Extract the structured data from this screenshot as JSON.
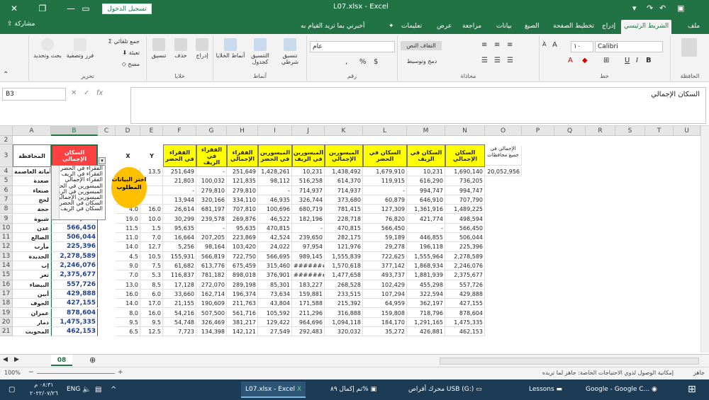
{
  "window": {
    "title": "L07.xlsx - Excel",
    "login_label": "تسجيل الدخول"
  },
  "ribbon_tabs": [
    "ملف",
    "الشريط الرئيسي",
    "إدراج",
    "تخطيط الصفحة",
    "الصيغ",
    "بيانات",
    "مراجعة",
    "عرض",
    "تعليمات"
  ],
  "tell_me": "أخبرني بما تريد القيام به",
  "share_label": "مشاركة",
  "ribbon": {
    "clipboard_label": "الحافظة",
    "font_label": "خط",
    "font_name": "Calibri",
    "font_size": "١٠",
    "alignment_label": "محاذاة",
    "wrap_text": "التفاف النص",
    "merge_center": "دمج وتوسيط",
    "number_label": "رقم",
    "number_format": "عام",
    "styles_label": "أنماط",
    "conditional_format": "تنسيق شرطي",
    "format_as_table": "التنسيق كجدول",
    "cell_styles": "أنماط الخلايا",
    "cells_label": "خلايا",
    "insert": "إدراج",
    "delete": "حذف",
    "format": "تنسيق",
    "editing_label": "تحرير",
    "autosum": "جمع تلقائي",
    "fill": "تعبئة",
    "clear": "مسح",
    "sort_filter": "فرز وتصفية",
    "find_select": "بحث وتحديد"
  },
  "formula": {
    "name_box": "B3",
    "content": "السكان الإجمالي"
  },
  "columns": [
    "A",
    "B",
    "C",
    "D",
    "E",
    "F",
    "G",
    "H",
    "I",
    "J",
    "K",
    "L",
    "M",
    "N",
    "O",
    "P",
    "Q",
    "R",
    "S",
    "T",
    "U"
  ],
  "headers": {
    "A": "المحافظة",
    "B": "السكان الإجمالي",
    "D": "X",
    "E": "Y",
    "F": "الفقراء في الحضر",
    "G": "الفقراء في الريف",
    "H": "الفقراء الإجمالي",
    "I": "الميسورين في الحضر",
    "J": "الميسورين في الريف",
    "K": "الميسورين الإجمالي",
    "L": "السكان في الحضر",
    "M": "السكان في الريف",
    "N": "السكان الإجمالي",
    "O": "الإجمالي في جميع محافظات",
    "O_value": "20,052,956"
  },
  "dropdown_items": [
    "الفقراء في الحضر",
    "الفقراء في الريف",
    "الفقراء الإجمالي",
    "الميسورين في الحضر",
    "الميسورين في الريف",
    "الميسورين الإجمالي",
    "السكان في الحضر",
    "السكان في الريف"
  ],
  "callout": "اختر البيانات المطلوب",
  "rows": [
    {
      "n": "4",
      "A": "أمانة العاصمة",
      "B": "",
      "D": "",
      "E": "13.5",
      "F": "251,649",
      "G": "-",
      "H": "251,649",
      "I": "1,428,261",
      "J": "10,231",
      "K": "1,438,492",
      "L": "1,679,910",
      "M": "10,231",
      "N": "1,690,140"
    },
    {
      "n": "5",
      "A": "صعدة",
      "B": "",
      "D": "",
      "E": "",
      "F": "21,803",
      "G": "100,032",
      "H": "121,835",
      "I": "98,112",
      "J": "516,258",
      "K": "614,370",
      "L": "119,915",
      "M": "616,290",
      "N": "736,205"
    },
    {
      "n": "6",
      "A": "صنعاء",
      "B": "",
      "D": "",
      "E": "",
      "F": "-",
      "G": "279,810",
      "H": "279,810",
      "I": "-",
      "J": "714,937",
      "K": "714,937",
      "L": "-",
      "M": "994,747",
      "N": "994,747"
    },
    {
      "n": "7",
      "A": "لحج",
      "B": "",
      "D": "",
      "E": "",
      "F": "13,944",
      "G": "320,166",
      "H": "334,110",
      "I": "46,935",
      "J": "326,744",
      "K": "373,680",
      "L": "60,879",
      "M": "646,910",
      "N": "707,790"
    },
    {
      "n": "8",
      "A": "حجة",
      "B": "",
      "D": "4.0",
      "E": "16.0",
      "F": "26,614",
      "G": "681,197",
      "H": "707,810",
      "I": "100,696",
      "J": "680,719",
      "K": "781,415",
      "L": "127,309",
      "M": "1,361,916",
      "N": "1,489,225"
    },
    {
      "n": "9",
      "A": "شبوة",
      "B": "498,594",
      "D": "19.0",
      "E": "10.0",
      "F": "30,299",
      "G": "239,578",
      "H": "269,876",
      "I": "46,522",
      "J": "182,196",
      "K": "228,718",
      "L": "76,820",
      "M": "421,774",
      "N": "498,594"
    },
    {
      "n": "10",
      "A": "عدن",
      "B": "566,450",
      "D": "11.5",
      "E": "1.5",
      "F": "95,635",
      "G": "-",
      "H": "95,635",
      "I": "470,815",
      "J": "-",
      "K": "470,815",
      "L": "566,450",
      "M": "-",
      "N": "566,450"
    },
    {
      "n": "11",
      "A": "الضالع",
      "B": "506,044",
      "D": "11.0",
      "E": "7.0",
      "F": "16,664",
      "G": "207,205",
      "H": "223,869",
      "I": "42,524",
      "J": "239,650",
      "K": "282,175",
      "L": "59,189",
      "M": "446,855",
      "N": "506,044"
    },
    {
      "n": "12",
      "A": "مأرب",
      "B": "225,396",
      "D": "14.0",
      "E": "12.7",
      "F": "5,256",
      "G": "98,164",
      "H": "103,420",
      "I": "24,022",
      "J": "97,954",
      "K": "121,976",
      "L": "29,278",
      "M": "196,118",
      "N": "225,396"
    },
    {
      "n": "13",
      "A": "الحديدة",
      "B": "2,278,589",
      "D": "4.5",
      "E": "10.5",
      "F": "155,931",
      "G": "566,819",
      "H": "722,750",
      "I": "566,695",
      "J": "989,145",
      "K": "1,555,839",
      "L": "722,625",
      "M": "1,555,964",
      "N": "2,278,589"
    },
    {
      "n": "14",
      "A": "إب",
      "B": "2,246,076",
      "D": "9.0",
      "E": "7.5",
      "F": "61,682",
      "G": "613,776",
      "H": "675,459",
      "I": "315,460",
      "J": "#######",
      "K": "1,570,618",
      "L": "377,142",
      "M": "1,868,934",
      "N": "2,246,076"
    },
    {
      "n": "15",
      "A": "تعز",
      "B": "2,375,677",
      "D": "7.0",
      "E": "5.3",
      "F": "116,837",
      "G": "781,182",
      "H": "898,018",
      "I": "376,901",
      "J": "#######",
      "K": "1,477,658",
      "L": "493,737",
      "M": "1,881,939",
      "N": "2,375,677"
    },
    {
      "n": "16",
      "A": "البيضاء",
      "B": "557,726",
      "D": "13.0",
      "E": "8.5",
      "F": "17,128",
      "G": "272,070",
      "H": "289,198",
      "I": "85,301",
      "J": "183,227",
      "K": "268,528",
      "L": "102,429",
      "M": "455,298",
      "N": "557,726"
    },
    {
      "n": "17",
      "A": "أبين",
      "B": "429,888",
      "D": "16.0",
      "E": "6.0",
      "F": "33,660",
      "G": "162,714",
      "H": "196,374",
      "I": "73,634",
      "J": "159,881",
      "K": "233,515",
      "L": "107,294",
      "M": "322,594",
      "N": "429,888"
    },
    {
      "n": "18",
      "A": "الجوف",
      "B": "427,155",
      "D": "14.0",
      "E": "17.0",
      "F": "21,155",
      "G": "190,609",
      "H": "211,763",
      "I": "43,804",
      "J": "171,588",
      "K": "215,392",
      "L": "64,959",
      "M": "362,197",
      "N": "427,155"
    },
    {
      "n": "19",
      "A": "عمران",
      "B": "878,604",
      "D": "8.0",
      "E": "16.0",
      "F": "54,216",
      "G": "507,500",
      "H": "561,716",
      "I": "105,592",
      "J": "211,296",
      "K": "316,888",
      "L": "159,808",
      "M": "718,796",
      "N": "878,604"
    },
    {
      "n": "20",
      "A": "ذمار",
      "B": "1,475,335",
      "D": "9.5",
      "E": "9.5",
      "F": "54,748",
      "G": "326,469",
      "H": "381,217",
      "I": "129,422",
      "J": "964,696",
      "K": "1,094,118",
      "L": "184,170",
      "M": "1,291,165",
      "N": "1,475,335"
    },
    {
      "n": "21",
      "A": "المحويت",
      "B": "462,153",
      "D": "6.5",
      "E": "12.5",
      "F": "7,723",
      "G": "134,398",
      "H": "142,121",
      "I": "27,549",
      "J": "292,483",
      "K": "320,032",
      "L": "35,272",
      "M": "426,881",
      "N": "462,153"
    }
  ],
  "sheet": {
    "tab": "08"
  },
  "status": {
    "ready": "جاهز",
    "accessibility": "إمكانية الوصول لذوي الاحتياجات الخاصة: جاهز لما تريده",
    "zoom": "100%"
  },
  "taskbar": {
    "chrome": "Google - Google C...",
    "lessons": "Lessons",
    "usb": "محرك أقراص USB (G:)",
    "progress": "تم إكمال ٨٩%",
    "excel": "L07.xlsx - Excel",
    "lang": "ENG",
    "time": "٠٨:٣١ م",
    "date": "٢٠٢٢/٠٧/٢٦"
  }
}
